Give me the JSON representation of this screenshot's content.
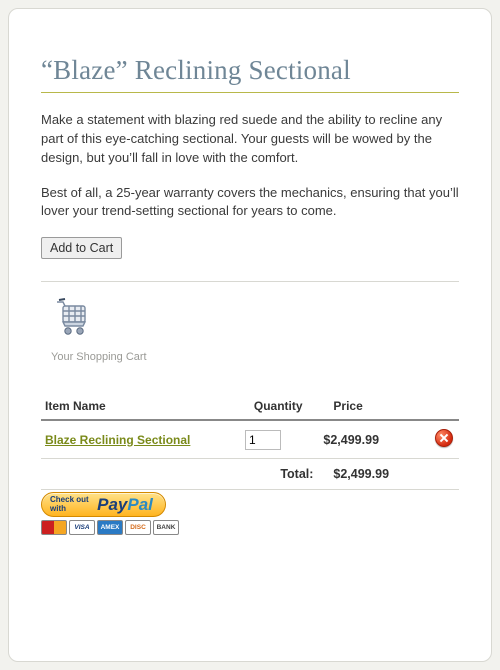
{
  "title": "“Blaze” Reclining Sectional",
  "description_p1": "Make a statement with blazing red suede and the ability to recline any part of this eye-catching sectional. Your guests will be wowed by the design, but you’ll fall in love with the comfort.",
  "description_p2": "Best of all, a 25-year warranty covers the mechanics, ensuring that you’ll lover your trend-setting sectional for years to come.",
  "add_to_cart_label": "Add to Cart",
  "cart": {
    "heading": "Your Shopping Cart",
    "columns": {
      "name": "Item Name",
      "qty": "Quantity",
      "price": "Price"
    },
    "items": [
      {
        "name": "Blaze Reclining Sectional",
        "quantity": "1",
        "price": "$2,499.99"
      }
    ],
    "total_label": "Total:",
    "total_value": "$2,499.99"
  },
  "checkout": {
    "line1": "Check out",
    "line2": "with",
    "brand_a": "Pay",
    "brand_b": "Pal",
    "methods": [
      "MC",
      "VISA",
      "AMEX",
      "DISC",
      "BANK"
    ]
  }
}
